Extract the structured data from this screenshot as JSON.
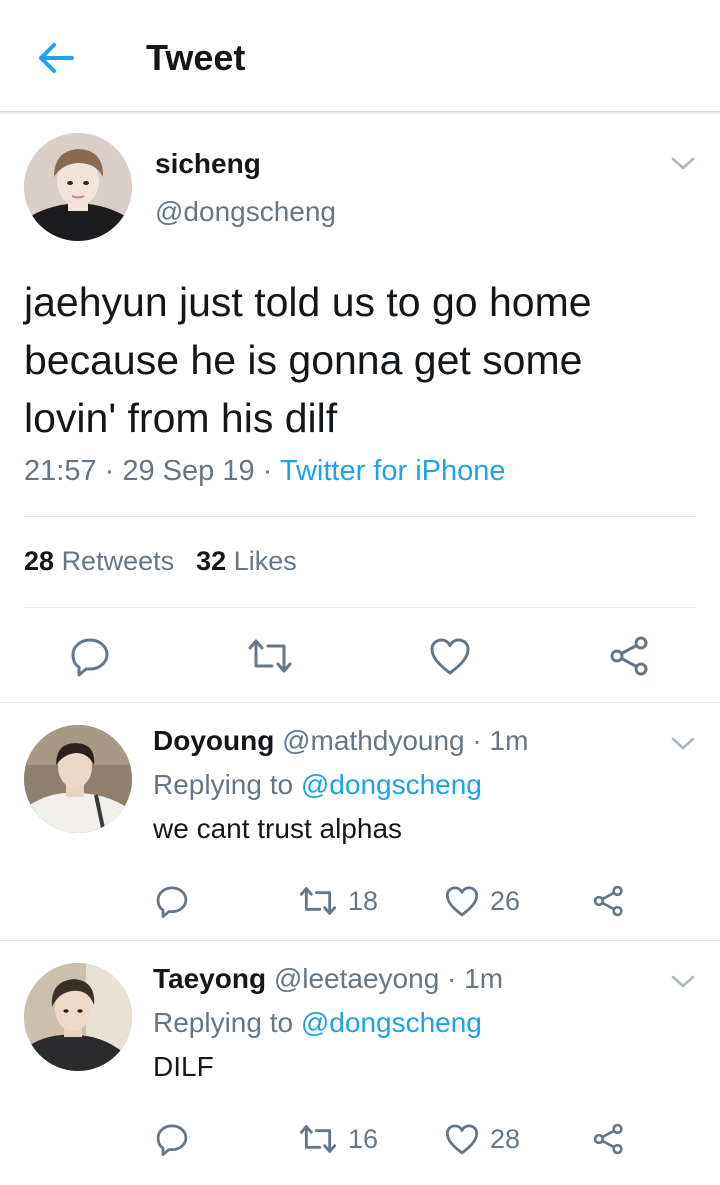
{
  "header": {
    "title": "Tweet"
  },
  "main_tweet": {
    "name": "sicheng",
    "handle": "@dongscheng",
    "text": "jaehyun just told us to go home because he is gonna get some lovin' from his dilf",
    "time": "21:57",
    "date": "29 Sep 19",
    "source": "Twitter for iPhone",
    "retweets_count": "28",
    "retweets_label": "Retweets",
    "likes_count": "32",
    "likes_label": "Likes"
  },
  "replies": [
    {
      "name": "Doyoung",
      "handle": "@mathdyoung",
      "time": "1m",
      "replying_label": "Replying to",
      "replying_to": "@dongscheng",
      "text": "we cant trust alphas",
      "retweets": "18",
      "likes": "26"
    },
    {
      "name": "Taeyong",
      "handle": "@leetaeyong",
      "time": "1m",
      "replying_label": "Replying to",
      "replying_to": "@dongscheng",
      "text": "DILF",
      "retweets": "16",
      "likes": "28"
    }
  ],
  "colors": {
    "accent": "#1da1f2",
    "secondary_text": "#657786",
    "primary_text": "#14171a",
    "divider": "#e1e8ed"
  },
  "icons": [
    "arrow-left-icon",
    "chevron-down-icon",
    "reply-icon",
    "retweet-icon",
    "heart-icon",
    "share-icon"
  ]
}
